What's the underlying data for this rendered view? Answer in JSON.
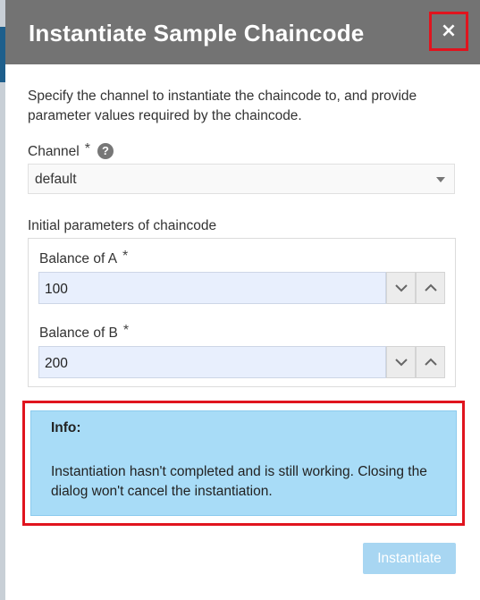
{
  "dialog": {
    "title": "Instantiate Sample Chaincode",
    "close_label": "×",
    "description": "Specify the channel to instantiate the chaincode to, and provide parameter values required by the chaincode."
  },
  "channel": {
    "label": "Channel",
    "required_mark": "*",
    "help_icon": "?",
    "selected": "default"
  },
  "params": {
    "section_label": "Initial parameters of chaincode",
    "fields": [
      {
        "label": "Balance of A",
        "required_mark": "*",
        "value": "100"
      },
      {
        "label": "Balance of B",
        "required_mark": "*",
        "value": "200"
      }
    ]
  },
  "info": {
    "title": "Info:",
    "text": "Instantiation hasn't completed and is still working. Closing the dialog won't cancel the instantiation."
  },
  "actions": {
    "instantiate_label": "Instantiate"
  },
  "colors": {
    "header_bg": "#737373",
    "highlight_outline": "#e0141e",
    "info_bg": "#a8dcf7",
    "input_bg": "#e8effd",
    "disabled_button": "#a8d6f2"
  }
}
